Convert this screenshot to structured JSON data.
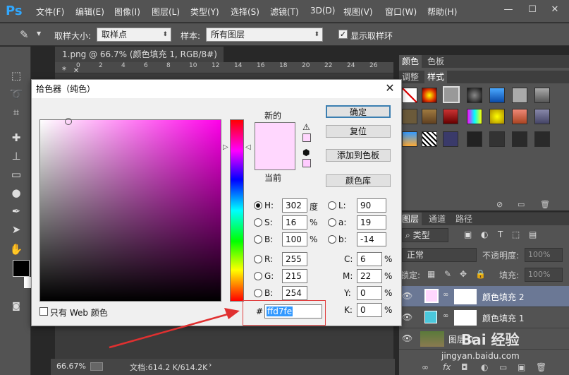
{
  "app": {
    "logo": "Ps"
  },
  "menu": [
    "文件(F)",
    "编辑(E)",
    "图像(I)",
    "图层(L)",
    "类型(Y)",
    "选择(S)",
    "滤镜(T)",
    "3D(D)",
    "视图(V)",
    "窗口(W)",
    "帮助(H)"
  ],
  "window_controls": {
    "minimize": "—",
    "maximize": "☐",
    "close": "✕"
  },
  "options": {
    "sample_size_label": "取样大小:",
    "sample_size_value": "取样点",
    "sample_label": "样本:",
    "sample_value": "所有图层",
    "show_ring_label": "显示取样环",
    "show_ring_checked": true
  },
  "document": {
    "tab_title": "1.png @ 66.7% (颜色填充 1, RGB/8#) *",
    "tab_close": "✕",
    "ruler_ticks": [
      "0",
      "2",
      "4",
      "6",
      "8",
      "10",
      "12",
      "14",
      "16",
      "18",
      "20",
      "22",
      "24",
      "26"
    ],
    "zoom": "66.67%",
    "doc_info": "文档:614.2 K/614.2K"
  },
  "panels": {
    "top_tabs": [
      "颜色",
      "色板"
    ],
    "sub_tabs": [
      "调整",
      "样式"
    ],
    "layer_tabs": [
      "图层",
      "通道",
      "路径"
    ],
    "kind_filter": "类型",
    "blend_mode": "正常",
    "opacity_label": "不透明度:",
    "opacity_value": "100%",
    "lock_label": "锁定:",
    "fill_label": "填充:",
    "fill_value": "100%",
    "layers": [
      {
        "name": "颜色填充 2",
        "swatch": "#ffd7fe",
        "selected": true
      },
      {
        "name": "颜色填充 1",
        "swatch": "#4bc8dc",
        "selected": false
      },
      {
        "name": "图层 0",
        "swatch": "#8a7a50",
        "selected": false
      }
    ],
    "watermark": "Bai 经验",
    "watermark_url": "jingyan.baidu.com"
  },
  "dialog": {
    "title": "拾色器（纯色）",
    "close": "✕",
    "new_label": "新的",
    "current_label": "当前",
    "new_color": "#ffd7fe",
    "current_color": "#ffd7fe",
    "buttons": {
      "ok": "确定",
      "reset": "复位",
      "add_swatch": "添加到色板",
      "color_library": "颜色库"
    },
    "fields": {
      "H": {
        "label": "H:",
        "value": "302",
        "unit": "度"
      },
      "S": {
        "label": "S:",
        "value": "16",
        "unit": "%"
      },
      "B": {
        "label": "B:",
        "value": "100",
        "unit": "%"
      },
      "R": {
        "label": "R:",
        "value": "255"
      },
      "G": {
        "label": "G:",
        "value": "215"
      },
      "Bv": {
        "label": "B:",
        "value": "254"
      },
      "L": {
        "label": "L:",
        "value": "90"
      },
      "a": {
        "label": "a:",
        "value": "19"
      },
      "b": {
        "label": "b:",
        "value": "-14"
      },
      "C": {
        "label": "C:",
        "value": "6",
        "unit": "%"
      },
      "M": {
        "label": "M:",
        "value": "22",
        "unit": "%"
      },
      "Y": {
        "label": "Y:",
        "value": "0",
        "unit": "%"
      },
      "K": {
        "label": "K:",
        "value": "0",
        "unit": "%"
      }
    },
    "hex_label": "#",
    "hex_value": "ffd7fe",
    "web_only_label": "只有 Web 颜色",
    "selected_mode": "H"
  }
}
